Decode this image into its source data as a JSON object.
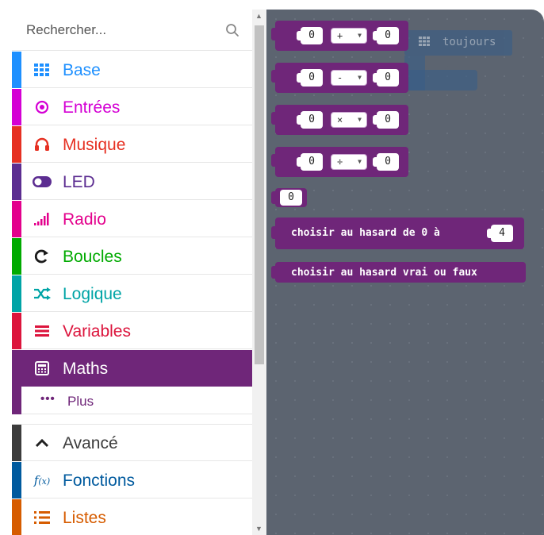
{
  "search": {
    "placeholder": "Rechercher..."
  },
  "categories": [
    {
      "label": "Base",
      "color": "#1e90ff",
      "icon": "grid-icon"
    },
    {
      "label": "Entrées",
      "color": "#d400d4",
      "icon": "target-icon"
    },
    {
      "label": "Musique",
      "color": "#e63022",
      "icon": "headphones-icon"
    },
    {
      "label": "LED",
      "color": "#5c2d91",
      "icon": "toggle-icon"
    },
    {
      "label": "Radio",
      "color": "#e3008c",
      "icon": "signal-icon"
    },
    {
      "label": "Boucles",
      "color": "#00aa00",
      "icon": "loop-arrow-icon"
    },
    {
      "label": "Logique",
      "color": "#00a4a6",
      "icon": "shuffle-icon"
    },
    {
      "label": "Variables",
      "color": "#dc143c",
      "icon": "list-lines-icon"
    },
    {
      "label": "Maths",
      "color": "#6f2679",
      "icon": "calculator-icon",
      "selected": true
    }
  ],
  "maths_sub": {
    "dots": "•••",
    "label": "Plus"
  },
  "advanced": [
    {
      "label": "Avancé",
      "color": "#3c3c3c",
      "icon": "chevron-up-icon"
    },
    {
      "label": "Fonctions",
      "color": "#005a9e",
      "icon": "function-icon"
    },
    {
      "label": "Listes",
      "color": "#d65c00",
      "icon": "numbered-list-icon"
    }
  ],
  "workspace": {
    "forever_label": "toujours",
    "blocks": [
      {
        "type": "arith",
        "left": "0",
        "op": "+",
        "right": "0"
      },
      {
        "type": "arith",
        "left": "0",
        "op": "-",
        "right": "0"
      },
      {
        "type": "arith",
        "left": "0",
        "op": "×",
        "right": "0"
      },
      {
        "type": "arith",
        "left": "0",
        "op": "÷",
        "right": "0"
      },
      {
        "type": "number",
        "value": "0"
      },
      {
        "type": "random",
        "text": "choisir au hasard de 0 à",
        "value": "4"
      },
      {
        "type": "random-bool",
        "text": "choisir au hasard vrai ou faux"
      }
    ]
  }
}
